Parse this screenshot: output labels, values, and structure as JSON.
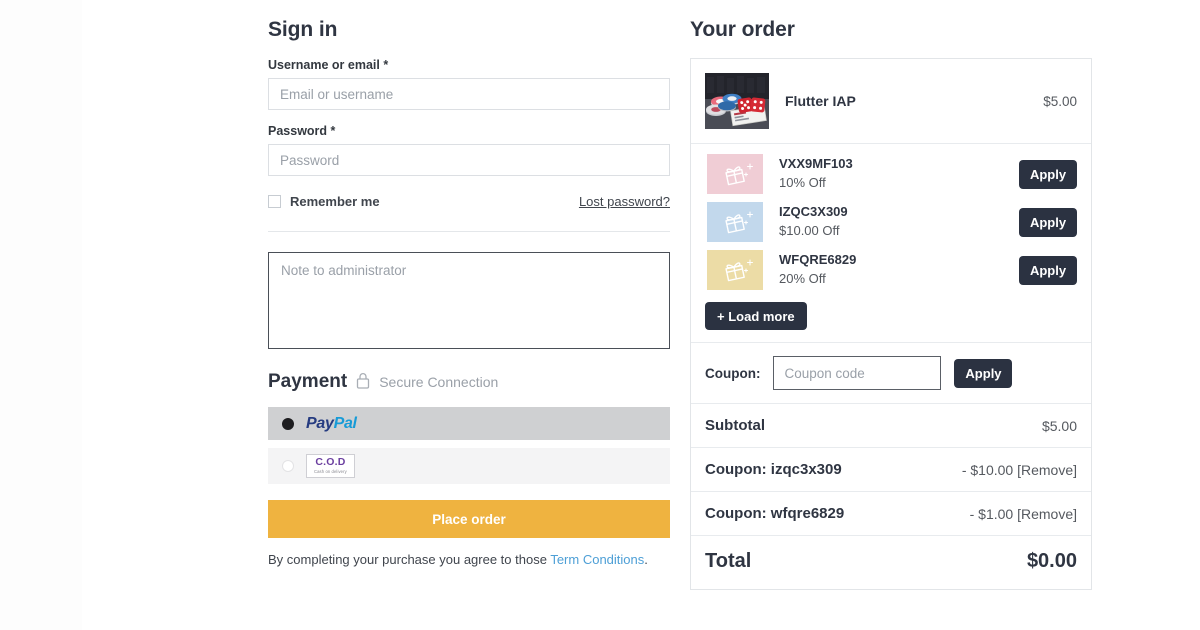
{
  "signin": {
    "title": "Sign in",
    "username_label": "Username or email *",
    "username_placeholder": "Email or username",
    "password_label": "Password *",
    "password_placeholder": "Password",
    "remember_label": "Remember me",
    "lost_password_label": "Lost password?",
    "note_placeholder": "Note to administrator"
  },
  "payment": {
    "title": "Payment",
    "secure_label": "Secure Connection",
    "lock_icon": "lock-icon",
    "methods": [
      {
        "id": "paypal",
        "label": "PayPal",
        "logo_part1": "Pay",
        "logo_part2": "Pal",
        "selected": true
      },
      {
        "id": "cod",
        "label": "C.O.D",
        "sublabel": "Cash on delivery",
        "selected": false
      }
    ],
    "place_order_label": "Place order",
    "terms_prefix": "By completing your purchase you agree to those ",
    "terms_link_label": "Term Conditions",
    "terms_suffix": "."
  },
  "order": {
    "title": "Your order",
    "product": {
      "name": "Flutter IAP",
      "price": "$5.00",
      "thumbnail_icon": "casino-chips-dice-image"
    },
    "coupons": [
      {
        "code": "VXX9MF103",
        "discount": "10% Off",
        "apply_label": "Apply",
        "color": "#f0cdd5",
        "icon": "gift-box-icon"
      },
      {
        "code": "IZQC3X309",
        "discount": "$10.00 Off",
        "apply_label": "Apply",
        "color": "#c2d8ec",
        "icon": "gift-box-icon"
      },
      {
        "code": "WFQRE6829",
        "discount": "20% Off",
        "apply_label": "Apply",
        "color": "#ecdca6",
        "icon": "gift-box-icon"
      }
    ],
    "load_more_label": "+ Load more",
    "coupon_entry": {
      "label": "Coupon:",
      "placeholder": "Coupon code",
      "value": "",
      "apply_label": "Apply"
    },
    "totals": [
      {
        "label": "Subtotal",
        "value": "$5.00",
        "type": "subtotal"
      },
      {
        "label": "Coupon: izqc3x309",
        "value": "- $10.00 [Remove]",
        "type": "coupon"
      },
      {
        "label": "Coupon: wfqre6829",
        "value": "- $1.00 [Remove]",
        "type": "coupon"
      },
      {
        "label": "Total",
        "value": "$0.00",
        "type": "grand"
      }
    ]
  },
  "colors": {
    "accent_button": "#efb340",
    "dark_button": "#2b3241",
    "link": "#4d9fd6",
    "paypal_dark": "#253b80",
    "paypal_light": "#179bd7",
    "cod_purple": "#6b3fa0"
  }
}
